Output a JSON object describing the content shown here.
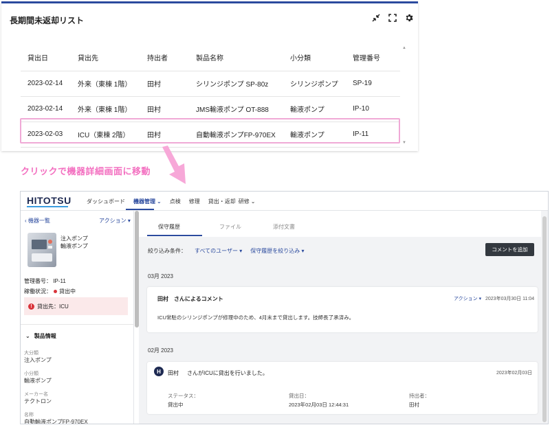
{
  "overdue_panel": {
    "title": "長期間未返却リスト",
    "icons": [
      "compress-icon",
      "expand-icon",
      "gear-icon"
    ],
    "columns": [
      "貸出日",
      "貸出先",
      "持出者",
      "製品名称",
      "小分類",
      "管理番号"
    ],
    "rows": [
      [
        "2023-02-14",
        "外来（東棟 1階）",
        "田村",
        "シリンジポンプ SP-80z",
        "シリンジポンプ",
        "SP-19"
      ],
      [
        "2023-02-14",
        "外来（東棟 1階）",
        "田村",
        "JMS輸液ポンプ OT-888",
        "輸液ポンプ",
        "IP-10"
      ],
      [
        "2023-02-03",
        "ICU（東棟 2階）",
        "田村",
        "自動輸液ポンプFP-970EX",
        "輸液ポンプ",
        "IP-11"
      ]
    ],
    "highlight_color": "#f0a9d6"
  },
  "caption": {
    "text": "クリックで機器詳細画面に移動",
    "color": "#f36fc0"
  },
  "app": {
    "logo": "HITOTSU",
    "nav": {
      "dashboard": "ダッシュボード",
      "equipment": "機器管理",
      "inspection": "点検",
      "repair": "修理",
      "lending": "貸出・返却",
      "training": "研修"
    },
    "sidebar": {
      "back": "機器一覧",
      "action": "アクション",
      "name1": "注入ポンプ",
      "name2": "輸液ポンプ",
      "mgmt_label": "管理番号：",
      "mgmt_value": "IP-11",
      "status_label": "稼働状況：",
      "status_value": "貸出中",
      "alert": "貸出先：ICU",
      "section": "製品情報",
      "fields": [
        {
          "label": "大分類",
          "value": "注入ポンプ"
        },
        {
          "label": "小分類",
          "value": "輸液ポンプ"
        },
        {
          "label": "メーカー名",
          "value": "テクトロン"
        },
        {
          "label": "名称",
          "value": "自動輸液ポンプFP-970EX"
        }
      ]
    },
    "tabs": [
      "保守履歴",
      "ファイル",
      "添付文書"
    ],
    "filter": {
      "label": "絞り込み条件：",
      "users": "すべてのユーザー",
      "history": "保守履歴を絞り込み"
    },
    "add_comment": "コメントを追加",
    "timeline": {
      "month1": "03月 2023",
      "card1": {
        "user": "田村",
        "suffix": "さんによるコメント",
        "action": "アクション",
        "date": "2023年03月30日 11:04",
        "body": "ICU常駐のシリンジポンプが修理中のため、4月末まで貸出します。技師長了承済み。"
      },
      "month2": "02月 2023",
      "card2": {
        "avatar": "H",
        "user": "田村",
        "text": "さんがICUに貸出を行いました。",
        "date": "2023年02月03日",
        "status_label": "ステータス：",
        "status_value": "貸出中",
        "lend_date_label": "貸出日：",
        "lend_date_value": "2023年02月03日 12:44:31",
        "person_label": "持出者：",
        "person_value": "田村"
      }
    }
  }
}
